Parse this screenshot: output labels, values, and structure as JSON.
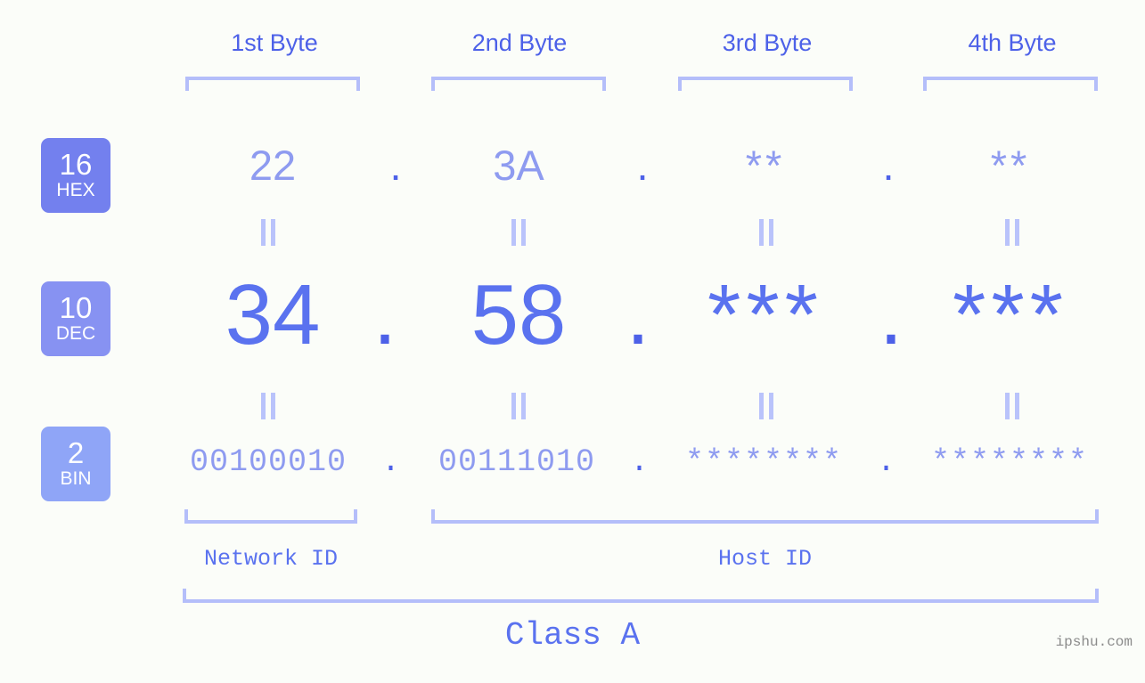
{
  "meta": {
    "background": "#fbfdf9",
    "accent": "#5a72ef",
    "accent_light": "#8e9bf0",
    "bracket_color": "#b4befa",
    "watermark": "ipshu.com"
  },
  "columns": [
    {
      "label": "1st Byte"
    },
    {
      "label": "2nd Byte"
    },
    {
      "label": "3rd Byte"
    },
    {
      "label": "4th Byte"
    }
  ],
  "radix_badges": [
    {
      "number": "16",
      "name": "HEX",
      "color": "#7380ee"
    },
    {
      "number": "10",
      "name": "DEC",
      "color": "#8792f2"
    },
    {
      "number": "2",
      "name": "BIN",
      "color": "#8fa5f7"
    }
  ],
  "rows": {
    "hex": {
      "values": [
        "22",
        "3A",
        "**",
        "**"
      ],
      "separator": "."
    },
    "dec": {
      "values": [
        "34",
        "58",
        "***",
        "***"
      ],
      "separator": "."
    },
    "bin": {
      "values": [
        "00100010",
        "00111010",
        "********",
        "********"
      ],
      "separator": "."
    }
  },
  "equal_marks": "||",
  "segments": {
    "network": {
      "label": "Network ID"
    },
    "host": {
      "label": "Host ID"
    }
  },
  "class": {
    "label": "Class A"
  }
}
